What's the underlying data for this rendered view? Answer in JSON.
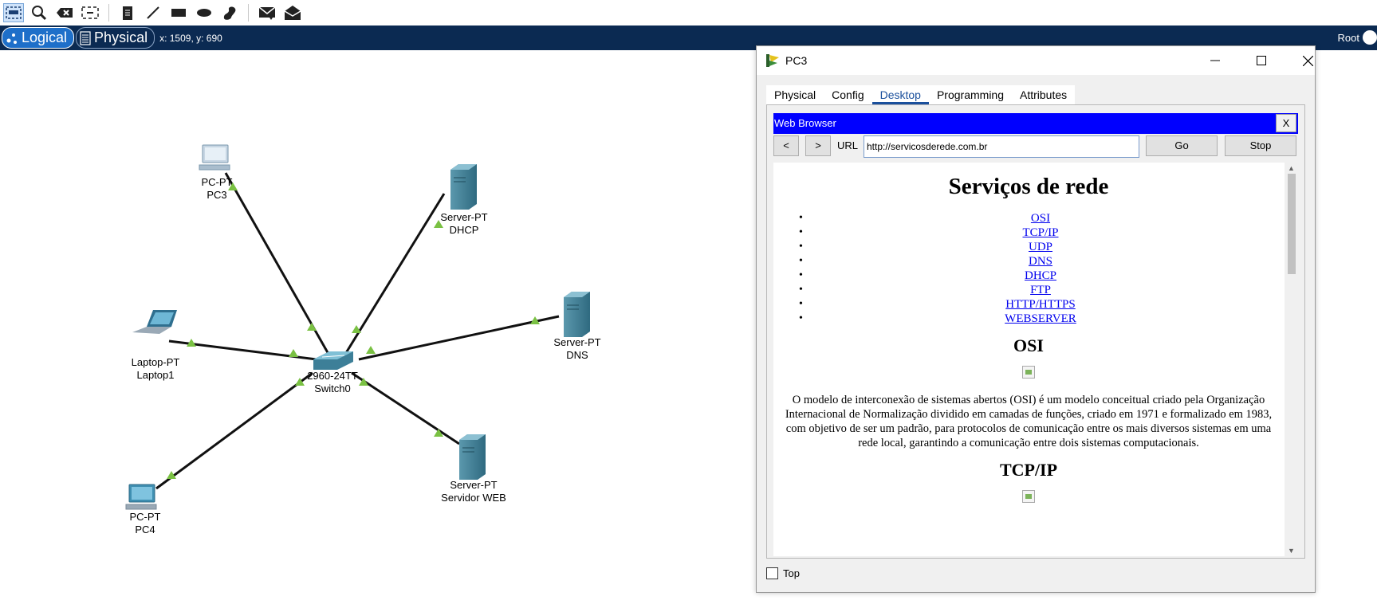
{
  "toolbar": {
    "tools": [
      "select-icon",
      "inspect-icon",
      "delete-icon",
      "resize-icon",
      "note-icon",
      "line-icon",
      "rectangle-icon",
      "ellipse-icon",
      "freeform-icon",
      "simple-pdu-icon",
      "complex-pdu-icon"
    ]
  },
  "modebar": {
    "logical_label": "Logical",
    "physical_label": "Physical",
    "coords": "x: 1509, y: 690",
    "root_label": "Root"
  },
  "devices": [
    {
      "type": "PC-PT",
      "name": "PC3"
    },
    {
      "type": "Server-PT",
      "name": "DHCP"
    },
    {
      "type": "Server-PT",
      "name": "DNS"
    },
    {
      "type": "Laptop-PT",
      "name": "Laptop1"
    },
    {
      "type": "2960-24TT",
      "name": "Switch0"
    },
    {
      "type": "PC-PT",
      "name": "PC4"
    },
    {
      "type": "Server-PT",
      "name": "Servidor WEB"
    }
  ],
  "link_color": "#7ac143",
  "window": {
    "title": "PC3",
    "tabs": [
      "Physical",
      "Config",
      "Desktop",
      "Programming",
      "Attributes"
    ],
    "active_tab": "Desktop",
    "browser": {
      "title": "Web Browser",
      "close_label": "X",
      "back_label": "<",
      "forward_label": ">",
      "url_label": "URL",
      "url_value": "http://servicosderede.com.br",
      "go_label": "Go",
      "stop_label": "Stop"
    },
    "page": {
      "heading": "Serviços de rede",
      "links": [
        "OSI",
        "TCP/IP",
        "UDP",
        "DNS",
        "DHCP",
        "FTP",
        "HTTP/HTTPS",
        "WEBSERVER"
      ],
      "section1_title": "OSI",
      "section1_text": "O modelo de interconexão de sistemas abertos (OSI) é um modelo conceitual criado pela Organização Internacional de Normalização dividido em camadas de funções, criado em 1971 e formalizado em 1983, com objetivo de ser um padrão, para protocolos de comunicação entre os mais diversos sistemas em uma rede local, garantindo a comunicação entre dois sistemas computacionais.",
      "section2_title": "TCP/IP"
    },
    "top_label": "Top"
  }
}
